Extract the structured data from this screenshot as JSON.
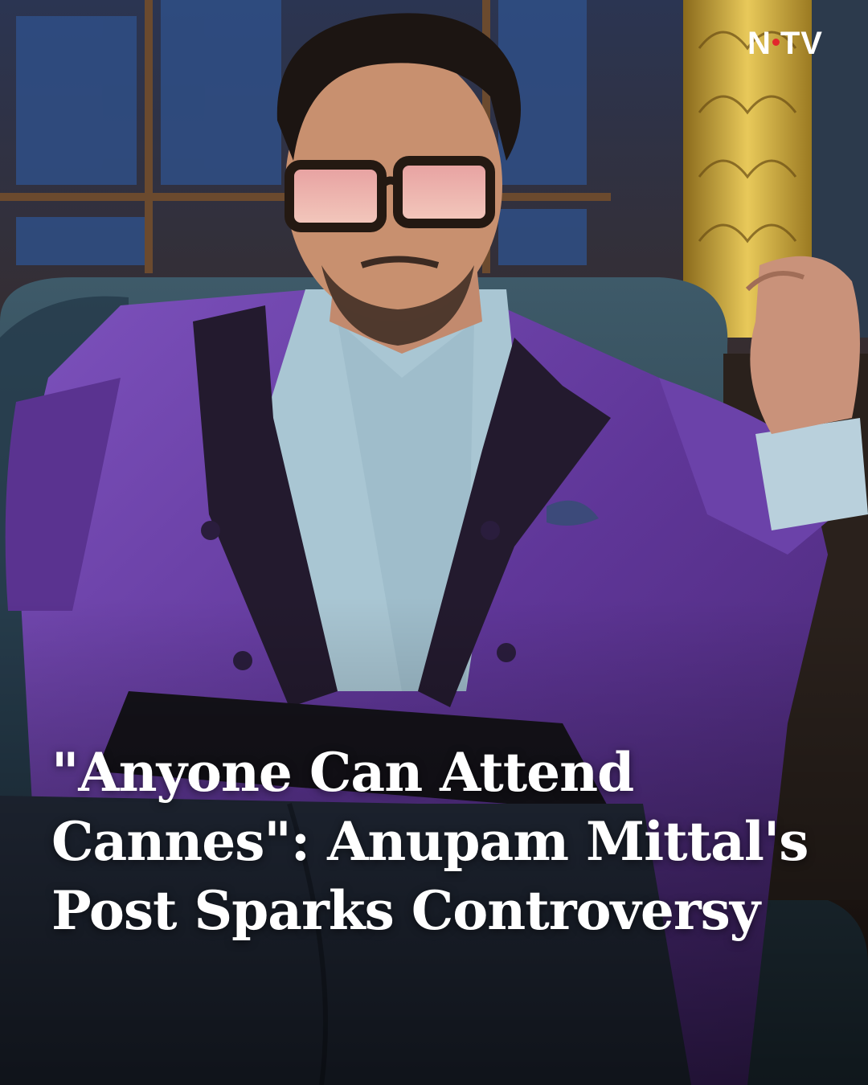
{
  "brand": {
    "logo_left": "N",
    "logo_right": "TV",
    "accent": "#e3262d"
  },
  "headline": {
    "line1": "\"Anyone Can Attend",
    "line2": "Cannes\": Anupam Mittal's",
    "line3": "Post Sparks Controversy"
  },
  "colors": {
    "jacket": "#6a3fa8",
    "shirt": "#a9c6d3",
    "chair": "#2f4856",
    "background": "#2a1e1a"
  }
}
